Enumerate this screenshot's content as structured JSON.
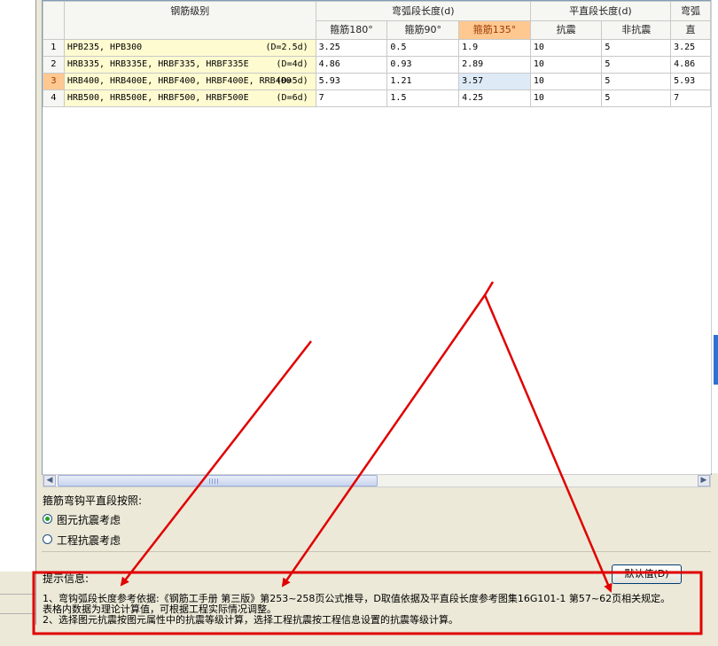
{
  "grid": {
    "header_top": {
      "grade": "钢筋级别",
      "arc": "弯弧段长度(d)",
      "straight": "平直段长度(d)",
      "arc2": "弯弧"
    },
    "header_sub": {
      "c180": "箍筋180°",
      "c90": "箍筋90°",
      "c135": "箍筋135°",
      "seismic": "抗震",
      "nonseismic": "非抗震",
      "straight2": "直"
    },
    "rows": [
      {
        "n": "1",
        "grade": "HPB235, HPB300",
        "d": "(D=2.5d)",
        "c180": "3.25",
        "c90": "0.5",
        "c135": "1.9",
        "seismic": "10",
        "nonseismic": "5",
        "extra": "3.25"
      },
      {
        "n": "2",
        "grade": "HRB335, HRB335E, HRBF335, HRBF335E",
        "d": "(D=4d)",
        "c180": "4.86",
        "c90": "0.93",
        "c135": "2.89",
        "seismic": "10",
        "nonseismic": "5",
        "extra": "4.86"
      },
      {
        "n": "3",
        "grade": "HRB400, HRB400E, HRBF400, HRBF400E, RRB400",
        "d": "(D=5d)",
        "c180": "5.93",
        "c90": "1.21",
        "c135": "3.57",
        "seismic": "10",
        "nonseismic": "5",
        "extra": "5.93"
      },
      {
        "n": "4",
        "grade": "HRB500, HRB500E, HRBF500, HRBF500E",
        "d": "(D=6d)",
        "c180": "7",
        "c90": "1.5",
        "c135": "4.25",
        "seismic": "10",
        "nonseismic": "5",
        "extra": "7"
      }
    ],
    "selected_row": 3,
    "selected_column": "箍筋135°"
  },
  "options": {
    "title": "箍筋弯钩平直段按照:",
    "radio1": "图元抗震考虑",
    "radio2": "工程抗震考虑",
    "selected": "图元抗震考虑"
  },
  "default_button": "默认值(D)",
  "info": {
    "title": "提示信息:",
    "line1": "1、弯钩弧段长度参考依据:《钢筋工手册 第三版》第253~258页公式推导，D取值依据及平直段长度参考图集16G101-1 第57~62页相关规定。",
    "line2": "表格内数据为理论计算值，可根据工程实际情况调整。",
    "line3": "2、选择图元抗震按图元属性中的抗震等级计算，选择工程抗震按工程信息设置的抗震等级计算。"
  },
  "colors": {
    "annotation": "#e00000",
    "selected_header": "#ffc891",
    "grade_cell": "#fffbd0",
    "highlight_cell": "#deebf7"
  },
  "icons": [
    "scroll-left-icon",
    "scroll-right-icon",
    "radio-selected-icon",
    "radio-unselected-icon"
  ]
}
